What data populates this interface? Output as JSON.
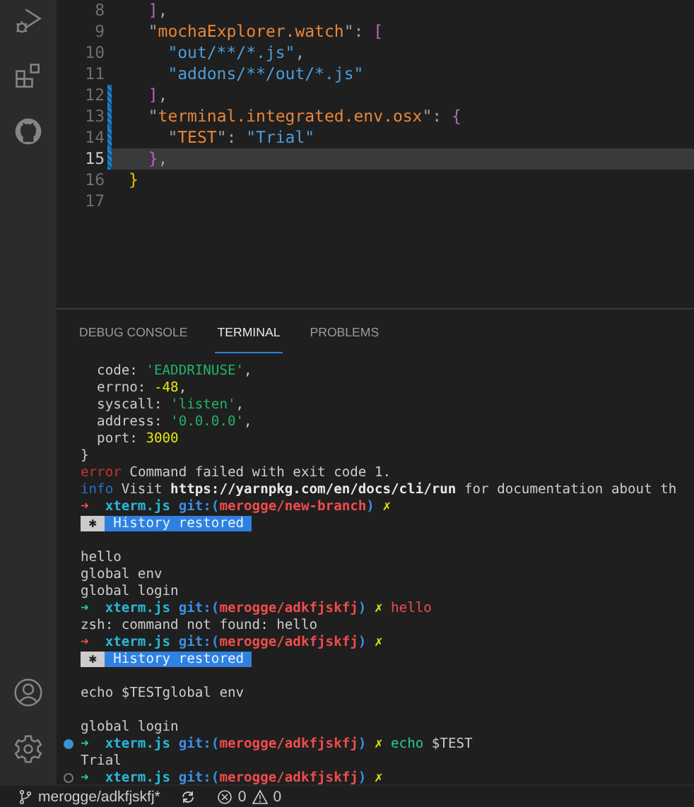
{
  "activity_bar": {
    "items": [
      {
        "kind": "debug"
      },
      {
        "kind": "extensions"
      },
      {
        "kind": "github"
      },
      {
        "kind": "account"
      },
      {
        "kind": "settings"
      }
    ]
  },
  "editor": {
    "lines": [
      {
        "number": "8",
        "modified": false,
        "current": false,
        "segments": [
          {
            "kind": "bracket",
            "text": "  ]"
          },
          {
            "kind": "punct",
            "text": ","
          }
        ]
      },
      {
        "number": "9",
        "modified": false,
        "current": false,
        "segments": [
          {
            "kind": "punct",
            "text": "  \""
          },
          {
            "kind": "key",
            "text": "mochaExplorer.watch"
          },
          {
            "kind": "punct",
            "text": "\": "
          },
          {
            "kind": "bracket",
            "text": "["
          }
        ]
      },
      {
        "number": "10",
        "modified": false,
        "current": false,
        "segments": [
          {
            "kind": "string",
            "text": "    \"out/**/*.js\""
          },
          {
            "kind": "punct",
            "text": ","
          }
        ]
      },
      {
        "number": "11",
        "modified": false,
        "current": false,
        "segments": [
          {
            "kind": "string",
            "text": "    \"addons/**/out/*.js\""
          }
        ]
      },
      {
        "number": "12",
        "modified": true,
        "current": false,
        "segments": [
          {
            "kind": "bracket",
            "text": "  ]"
          },
          {
            "kind": "punct",
            "text": ","
          }
        ]
      },
      {
        "number": "13",
        "modified": true,
        "current": false,
        "segments": [
          {
            "kind": "punct",
            "text": "  \""
          },
          {
            "kind": "key",
            "text": "terminal.integrated.env.osx"
          },
          {
            "kind": "punct",
            "text": "\": "
          },
          {
            "kind": "bracket",
            "text": "{"
          }
        ]
      },
      {
        "number": "14",
        "modified": true,
        "current": false,
        "segments": [
          {
            "kind": "punct",
            "text": "    \""
          },
          {
            "kind": "key",
            "text": "TEST"
          },
          {
            "kind": "punct",
            "text": "\": "
          },
          {
            "kind": "string",
            "text": "\"Trial\""
          }
        ]
      },
      {
        "number": "15",
        "modified": true,
        "current": true,
        "segments": [
          {
            "kind": "bracket",
            "text": "  }"
          },
          {
            "kind": "punct",
            "text": ","
          }
        ]
      },
      {
        "number": "16",
        "modified": false,
        "current": false,
        "segments": [
          {
            "kind": "brace",
            "text": "}"
          }
        ]
      },
      {
        "number": "17",
        "modified": false,
        "current": false
      }
    ]
  },
  "panel": {
    "tabs": [
      {
        "label": "DEBUG CONSOLE",
        "selected": false
      },
      {
        "label": "TERMINAL",
        "selected": true
      },
      {
        "label": "PROBLEMS",
        "selected": false
      }
    ],
    "terminal_lines": [
      {
        "segments": [
          {
            "kind": "plain",
            "text": "  code: "
          },
          {
            "kind": "green",
            "text": "'EADDRINUSE'"
          },
          {
            "kind": "plain",
            "text": ","
          }
        ]
      },
      {
        "segments": [
          {
            "kind": "plain",
            "text": "  errno: "
          },
          {
            "kind": "yellow",
            "text": "-48"
          },
          {
            "kind": "plain",
            "text": ","
          }
        ]
      },
      {
        "segments": [
          {
            "kind": "plain",
            "text": "  syscall: "
          },
          {
            "kind": "green",
            "text": "'listen'"
          },
          {
            "kind": "plain",
            "text": ","
          }
        ]
      },
      {
        "segments": [
          {
            "kind": "plain",
            "text": "  address: "
          },
          {
            "kind": "green",
            "text": "'0.0.0.0'"
          },
          {
            "kind": "plain",
            "text": ","
          }
        ]
      },
      {
        "segments": [
          {
            "kind": "plain",
            "text": "  port: "
          },
          {
            "kind": "yellow",
            "text": "3000"
          }
        ]
      },
      {
        "segments": [
          {
            "kind": "plain",
            "text": "}"
          }
        ]
      },
      {
        "segments": [
          {
            "kind": "error",
            "text": "error"
          },
          {
            "kind": "plain",
            "text": " Command failed with exit code 1."
          }
        ]
      },
      {
        "segments": [
          {
            "kind": "info",
            "text": "info"
          },
          {
            "kind": "plain",
            "text": " Visit "
          },
          {
            "kind": "bold",
            "text": "https://yarnpkg.com/en/docs/cli/run"
          },
          {
            "kind": "plain",
            "text": " for documentation about th"
          }
        ]
      },
      {
        "segments": [
          {
            "kind": "arrow-fail",
            "text": "➜  "
          },
          {
            "kind": "repo",
            "text": "xterm.js "
          },
          {
            "kind": "git",
            "text": "git:("
          },
          {
            "kind": "branch",
            "text": "merogge/new-branch"
          },
          {
            "kind": "git",
            "text": ")"
          },
          {
            "kind": "dirty",
            "text": " ✗"
          }
        ]
      },
      {
        "segments": [
          {
            "kind": "badge-icon",
            "text": " ✱ "
          },
          {
            "kind": "badge",
            "text": " History restored "
          }
        ]
      },
      {
        "kind": "blank"
      },
      {
        "segments": [
          {
            "kind": "plain",
            "text": "hello"
          }
        ]
      },
      {
        "segments": [
          {
            "kind": "plain",
            "text": "global env"
          }
        ]
      },
      {
        "segments": [
          {
            "kind": "plain",
            "text": "global login"
          }
        ]
      },
      {
        "segments": [
          {
            "kind": "arrow-ok",
            "text": "➜  "
          },
          {
            "kind": "repo",
            "text": "xterm.js "
          },
          {
            "kind": "git",
            "text": "git:("
          },
          {
            "kind": "branch",
            "text": "merogge/adkfjskfj"
          },
          {
            "kind": "git",
            "text": ")"
          },
          {
            "kind": "dirty",
            "text": " ✗ "
          },
          {
            "kind": "cmd-bad",
            "text": "hello"
          }
        ]
      },
      {
        "segments": [
          {
            "kind": "plain",
            "text": "zsh: command not found: hello"
          }
        ]
      },
      {
        "segments": [
          {
            "kind": "arrow-fail",
            "text": "➜  "
          },
          {
            "kind": "repo",
            "text": "xterm.js "
          },
          {
            "kind": "git",
            "text": "git:("
          },
          {
            "kind": "branch",
            "text": "merogge/adkfjskfj"
          },
          {
            "kind": "git",
            "text": ")"
          },
          {
            "kind": "dirty",
            "text": " ✗"
          }
        ]
      },
      {
        "segments": [
          {
            "kind": "badge-icon",
            "text": " ✱ "
          },
          {
            "kind": "badge",
            "text": " History restored "
          }
        ]
      },
      {
        "kind": "blank"
      },
      {
        "segments": [
          {
            "kind": "plain",
            "text": "echo $TESTglobal env"
          }
        ]
      },
      {
        "kind": "blank"
      },
      {
        "segments": [
          {
            "kind": "plain",
            "text": "global login"
          }
        ]
      },
      {
        "kind": "success",
        "segments": [
          {
            "kind": "arrow-ok",
            "text": "➜  "
          },
          {
            "kind": "repo",
            "text": "xterm.js "
          },
          {
            "kind": "git",
            "text": "git:("
          },
          {
            "kind": "branch",
            "text": "merogge/adkfjskfj"
          },
          {
            "kind": "git",
            "text": ")"
          },
          {
            "kind": "dirty",
            "text": " ✗ "
          },
          {
            "kind": "cmd-ok",
            "text": "echo"
          },
          {
            "kind": "plain",
            "text": " $TEST"
          }
        ]
      },
      {
        "segments": [
          {
            "kind": "plain",
            "text": "Trial"
          }
        ]
      },
      {
        "kind": "pending",
        "segments": [
          {
            "kind": "arrow-ok",
            "text": "➜  "
          },
          {
            "kind": "repo",
            "text": "xterm.js "
          },
          {
            "kind": "git",
            "text": "git:("
          },
          {
            "kind": "branch",
            "text": "merogge/adkfjskfj"
          },
          {
            "kind": "git",
            "text": ")"
          },
          {
            "kind": "dirty",
            "text": " ✗"
          }
        ]
      }
    ]
  },
  "status_bar": {
    "items": [
      {
        "kind": "branch",
        "text": "merogge/adkfjskfj*"
      },
      {
        "kind": "sync"
      },
      {
        "kind": "errors",
        "text": "0"
      },
      {
        "kind": "warnings",
        "text": "0"
      }
    ]
  }
}
